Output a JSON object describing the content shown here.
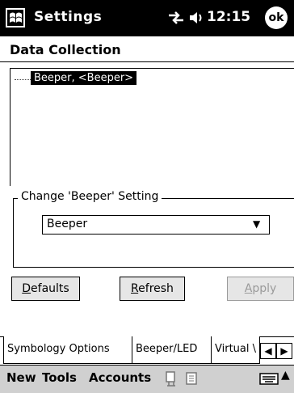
{
  "titlebar": {
    "title": "Settings",
    "time": "12:15",
    "ok": "ok"
  },
  "page": {
    "heading": "Data Collection"
  },
  "tree": {
    "items": [
      {
        "label": "Beeper, <Beeper>"
      }
    ]
  },
  "group": {
    "label": "Change 'Beeper' Setting",
    "select": {
      "value": "Beeper"
    }
  },
  "buttons": {
    "defaults": {
      "accel": "D",
      "rest": "efaults"
    },
    "refresh": {
      "accel": "R",
      "rest": "efresh"
    },
    "apply": {
      "accel": "A",
      "rest": "pply"
    }
  },
  "tabs": [
    {
      "label": "Symbology Options"
    },
    {
      "label": "Beeper/LED"
    },
    {
      "label": "Virtual \\"
    }
  ],
  "menu": {
    "new": "New",
    "tools": "Tools",
    "accounts": "Accounts"
  },
  "icons": {
    "start": "windows-flag-icon",
    "connectivity": "connectivity-icon",
    "volume": "speaker-icon",
    "keyboard": "keyboard-icon"
  }
}
